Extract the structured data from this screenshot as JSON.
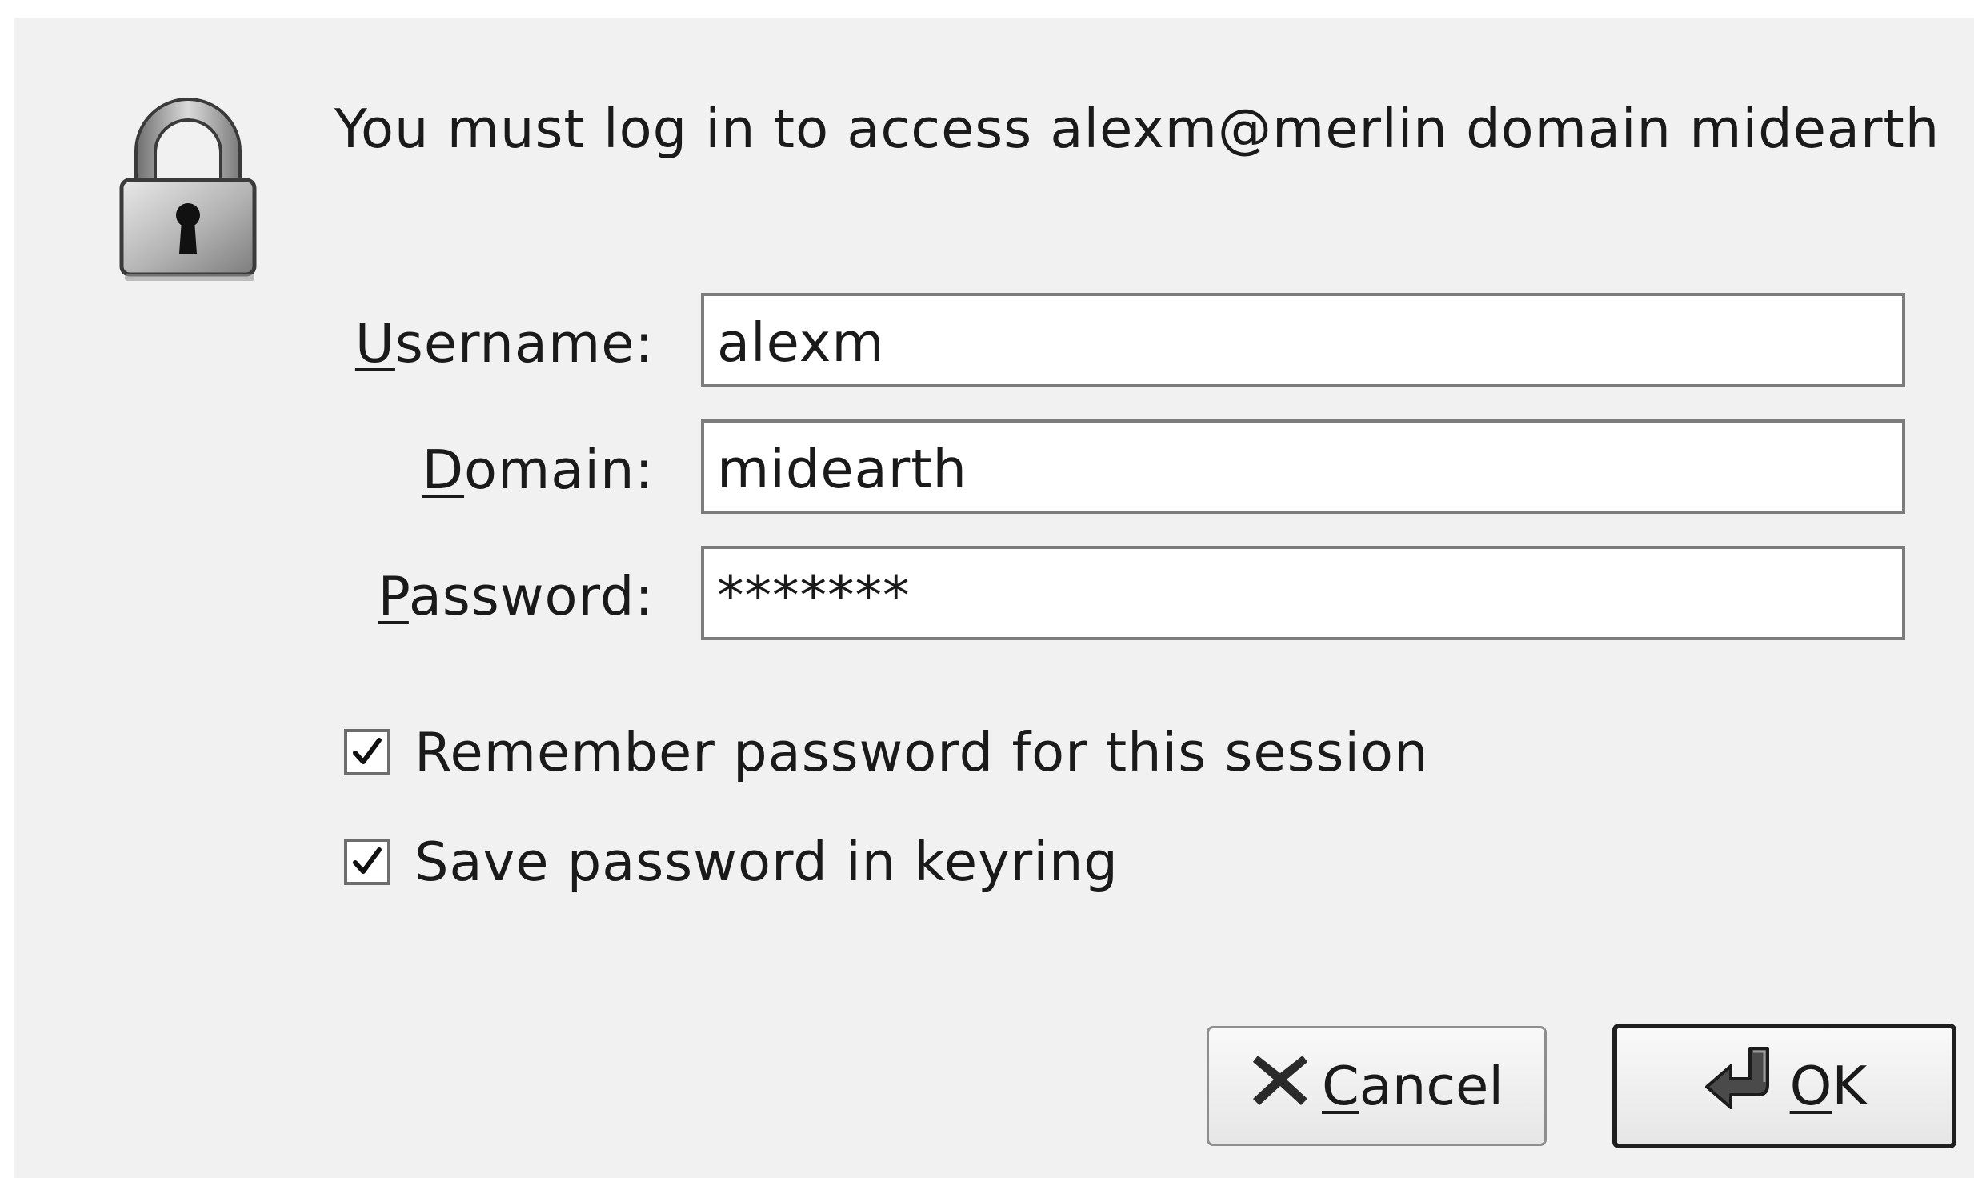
{
  "dialog": {
    "message": "You must log in to access alexm@merlin domain midearth",
    "icon": "padlock-icon"
  },
  "fields": {
    "username": {
      "label_mnemonic": "U",
      "label_rest": "sername:",
      "value": "alexm"
    },
    "domain": {
      "label_mnemonic": "D",
      "label_rest": "omain:",
      "value": "midearth"
    },
    "password": {
      "label_mnemonic": "P",
      "label_rest": "assword:",
      "value": "*******"
    }
  },
  "options": {
    "remember_session": {
      "label": "Remember password for this session",
      "checked": true
    },
    "save_keyring": {
      "label": "Save password in keyring",
      "checked": true
    }
  },
  "buttons": {
    "cancel": {
      "mnemonic": "C",
      "rest": "ancel",
      "icon": "close-x-icon"
    },
    "ok": {
      "mnemonic": "O",
      "rest": "K",
      "icon": "enter-arrow-icon"
    }
  }
}
